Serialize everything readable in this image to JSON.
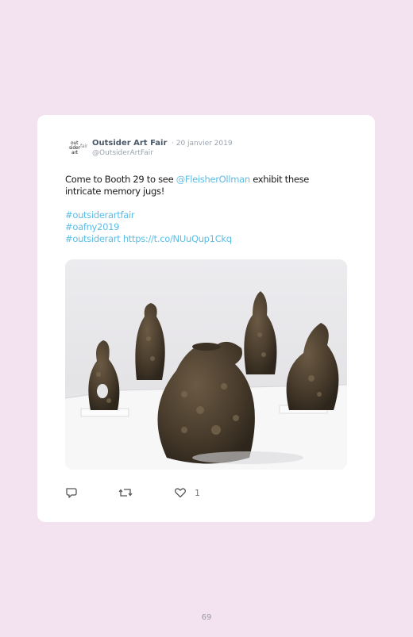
{
  "tweet": {
    "author_name": "Outsider Art Fair",
    "date": "· 20 janvier 2019",
    "handle": "@OutsiderArtFair",
    "avatar_logo_lines": [
      "out",
      "sider",
      "art",
      "fair"
    ],
    "text_part1": "Come to Booth 29 to see ",
    "mention": "@FleisherOllman",
    "text_part2": " exhibit these",
    "text_line2": "intricate memory jugs!",
    "hashtags": [
      "#outsiderartfair",
      "#oafny2019",
      "#outsiderart"
    ],
    "link": "https://t.co/NUuQup1Ckq",
    "like_count": "1",
    "image_description_icon": "photo-of-memory-jugs"
  },
  "actions": {
    "reply_icon": "reply-icon",
    "retweet_icon": "retweet-icon",
    "like_icon": "heart-icon"
  },
  "page": {
    "number": "69"
  },
  "colors": {
    "background": "#f3e3f1",
    "card": "#ffffff",
    "link": "#5bbde6",
    "muted": "#9aa3ab"
  }
}
